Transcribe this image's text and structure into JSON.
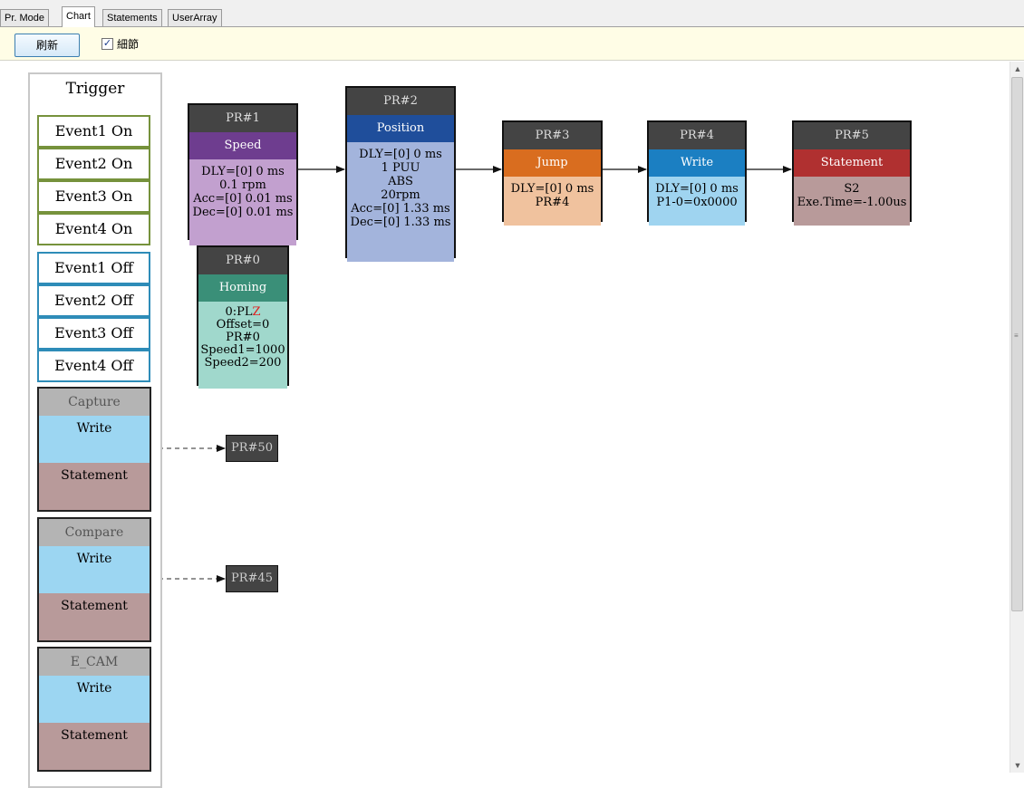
{
  "tabs": [
    "Pr. Mode",
    "Chart",
    "Statements",
    "UserArray"
  ],
  "toolbar": {
    "refresh_label": "刷新",
    "detail_label": "細節",
    "detail_checked": true
  },
  "trigger": {
    "title": "Trigger",
    "on_events": [
      "Event1 On",
      "Event2 On",
      "Event3 On",
      "Event4 On"
    ],
    "off_events": [
      "Event1 Off",
      "Event2 Off",
      "Event3 Off",
      "Event4 Off"
    ],
    "groups": [
      {
        "header": "Capture",
        "write": "Write",
        "statement": "Statement",
        "target": "PR#50"
      },
      {
        "header": "Compare",
        "write": "Write",
        "statement": "Statement",
        "target": "PR#45"
      },
      {
        "header": "E_CAM",
        "write": "Write",
        "statement": "Statement"
      }
    ]
  },
  "nodes": {
    "pr1": {
      "id": "PR#1",
      "type": "Speed",
      "color": "#6e3d8f",
      "body_color": "#c2a0cf",
      "lines": [
        "DLY=[0] 0 ms",
        "0.1 rpm",
        "Acc=[0] 0.01 ms",
        "Dec=[0] 0.01 ms"
      ]
    },
    "pr2": {
      "id": "PR#2",
      "type": "Position",
      "color": "#1f4e9b",
      "body_color": "#a3b4dc",
      "lines": [
        "DLY=[0] 0 ms",
        "1 PUU",
        "ABS",
        "20rpm",
        "Acc=[0] 1.33 ms",
        "Dec=[0] 1.33 ms"
      ]
    },
    "pr3": {
      "id": "PR#3",
      "type": "Jump",
      "color": "#d96d1f",
      "body_color": "#f0c29e",
      "lines": [
        "DLY=[0] 0 ms",
        "PR#4"
      ]
    },
    "pr4": {
      "id": "PR#4",
      "type": "Write",
      "color": "#1b7fc2",
      "body_color": "#9fd4f0",
      "lines": [
        "DLY=[0] 0 ms",
        "P1-0=0x0000"
      ]
    },
    "pr5": {
      "id": "PR#5",
      "type": "Statement",
      "color": "#b03030",
      "body_color": "#b89a9a",
      "lines": [
        "S2",
        "Exe.Time=-1.00us"
      ]
    },
    "pr0": {
      "id": "PR#0",
      "type": "Homing",
      "color": "#3a8f78",
      "body_color": "#a0d8cc",
      "line0a": "0:PL",
      "line0b": "Z",
      "lines": [
        "Offset=0",
        "PR#0",
        "Speed1=1000",
        "Speed2=200"
      ]
    }
  }
}
